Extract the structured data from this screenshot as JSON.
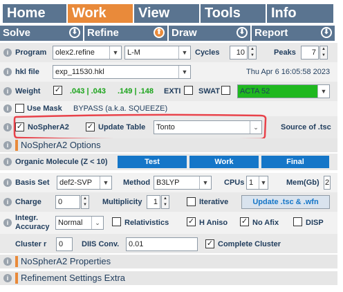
{
  "tabs": [
    "Home",
    "Work",
    "View",
    "Tools",
    "Info"
  ],
  "subtabs": [
    "Solve",
    "Refine",
    "Draw",
    "Report"
  ],
  "program": {
    "label": "Program",
    "value": "olex2.refine",
    "method": "L-M",
    "cycles_label": "Cycles",
    "cycles": "10",
    "peaks_label": "Peaks",
    "peaks": "7"
  },
  "hkl": {
    "label": "hkl file",
    "value": "exp_11530.hkl",
    "date": "Thu Apr 6 16:05:58 2023"
  },
  "weight": {
    "label": "Weight",
    "w1": ".043 | .043",
    "w2": ".149 | .148",
    "exti": "EXTI",
    "swat": "SWAT",
    "acta": "ACTA 52",
    "acta_color": "#1fb81f"
  },
  "mask": {
    "label": "Use Mask",
    "bypass": "BYPASS (a.k.a. SQUEEZE)"
  },
  "nosphera": {
    "label": "NoSpherA2",
    "update": "Update Table",
    "source": "Tonto",
    "source_label": "Source of .tsc"
  },
  "options_header": "NoSpherA2 Options",
  "organic": {
    "label": "Organic Molecule (Z < 10)",
    "test": "Test",
    "work": "Work",
    "final": "Final"
  },
  "basis": {
    "label": "Basis Set",
    "value": "def2-SVP",
    "method_label": "Method",
    "method": "B3LYP",
    "cpus_label": "CPUs",
    "cpus": "1",
    "mem_label": "Mem(Gb)",
    "mem": "2"
  },
  "charge": {
    "label": "Charge",
    "value": "0",
    "mult_label": "Multiplicity",
    "mult": "1",
    "iterative": "Iterative",
    "update_btn": "Update .tsc & .wfn"
  },
  "integr": {
    "label1": "Integr.",
    "label2": "Accuracy",
    "value": "Normal",
    "relativistics": "Relativistics",
    "haniso": "H Aniso",
    "noafix": "No Afix",
    "disp": "DISP"
  },
  "cluster": {
    "label": "Cluster r",
    "value": "0",
    "diis_label": "DIIS Conv.",
    "diis": "0.01",
    "complete": "Complete Cluster"
  },
  "props_header": "NoSpherA2 Properties",
  "extra_header": "Refinement Settings Extra",
  "highlight_color": "#e8424a"
}
